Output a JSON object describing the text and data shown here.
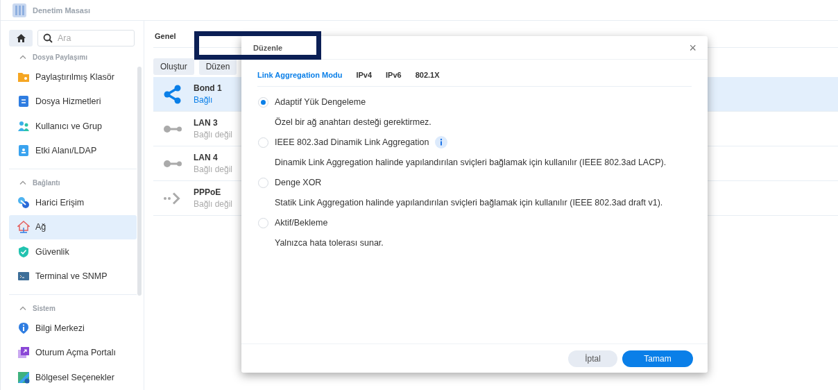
{
  "window": {
    "title": "Denetim Masası"
  },
  "sidebar": {
    "search": {
      "placeholder": "Ara"
    },
    "groups": [
      {
        "title": "Dosya Paylaşımı",
        "items": [
          {
            "label": "Paylaştırılmış Klasör",
            "selected": false
          },
          {
            "label": "Dosya Hizmetleri",
            "selected": false
          },
          {
            "label": "Kullanıcı ve Grup",
            "selected": false
          },
          {
            "label": "Etki Alanı/LDAP",
            "selected": false
          }
        ]
      },
      {
        "title": "Bağlantı",
        "items": [
          {
            "label": "Harici Erişim",
            "selected": false
          },
          {
            "label": "Ağ",
            "selected": true
          },
          {
            "label": "Güvenlik",
            "selected": false
          },
          {
            "label": "Terminal ve SNMP",
            "selected": false
          }
        ]
      },
      {
        "title": "Sistem",
        "items": [
          {
            "label": "Bilgi Merkezi",
            "selected": false
          },
          {
            "label": "Oturum Açma Portalı",
            "selected": false
          },
          {
            "label": "Bölgesel Seçenekler",
            "selected": false
          }
        ]
      }
    ]
  },
  "tabs": [
    {
      "label": "Genel",
      "selected": false
    }
  ],
  "toolbar": [
    {
      "label": "Oluştur"
    },
    {
      "label": "Düzen"
    }
  ],
  "interfaces": [
    {
      "kind": "bond",
      "name": "Bond 1",
      "status": "Bağlı",
      "connected": true,
      "selected": true
    },
    {
      "kind": "lan",
      "name": "LAN 3",
      "status": "Bağlı değil",
      "connected": false,
      "selected": false
    },
    {
      "kind": "lan",
      "name": "LAN 4",
      "status": "Bağlı değil",
      "connected": false,
      "selected": false
    },
    {
      "kind": "pppoe",
      "name": "PPPoE",
      "status": "Bağlı değil",
      "connected": false,
      "selected": false
    }
  ],
  "dialog": {
    "title": "Düzenle",
    "close": "×",
    "tabs": [
      {
        "label": "Link Aggregation Modu",
        "selected": true
      },
      {
        "label": "IPv4",
        "selected": false
      },
      {
        "label": "IPv6",
        "selected": false
      },
      {
        "label": "802.1X",
        "selected": false
      }
    ],
    "options": [
      {
        "label": "Adaptif Yük Dengeleme",
        "description": "Özel bir ağ anahtarı desteği gerektirmez.",
        "selected": true,
        "info": false
      },
      {
        "label": "IEEE 802.3ad Dinamik Link Aggregation",
        "description": "Dinamik Link Aggregation halinde yapılandırılan sviçleri bağlamak için kullanılır (IEEE 802.3ad LACP).",
        "selected": false,
        "info": true
      },
      {
        "label": "Denge XOR",
        "description": "Statik Link Aggregation halinde yapılandırılan sviçleri bağlamak için kullanılır (IEEE 802.3ad draft v1).",
        "selected": false,
        "info": false
      },
      {
        "label": "Aktif/Bekleme",
        "description": "Yalnızca hata tolerası sunar.",
        "selected": false,
        "info": false
      }
    ],
    "buttons": [
      {
        "kind": "cancel",
        "label": "İptal"
      },
      {
        "kind": "ok",
        "label": "Tamam"
      }
    ]
  }
}
